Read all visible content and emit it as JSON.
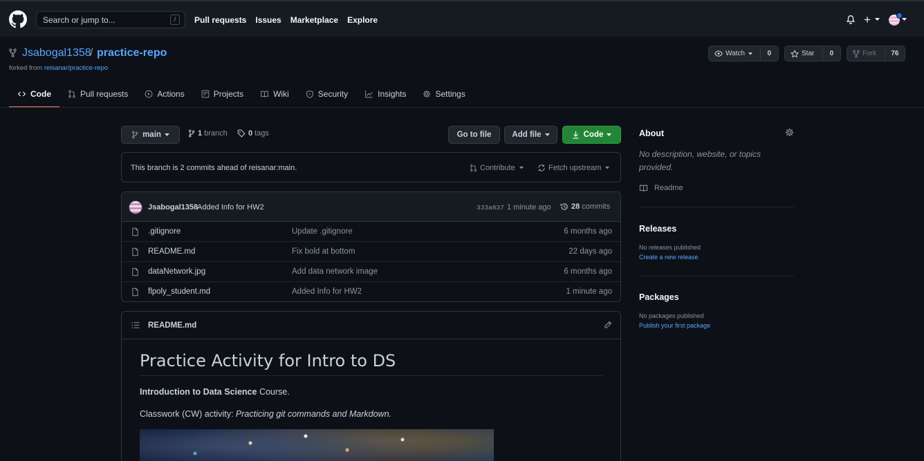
{
  "header": {
    "search_placeholder": "Search or jump to...",
    "search_shortcut": "/",
    "nav": [
      "Pull requests",
      "Issues",
      "Marketplace",
      "Explore"
    ],
    "plus": "+"
  },
  "repo": {
    "owner": "Jsabogal1358",
    "separator": "/",
    "name": "practice-repo",
    "forked_prefix": "forked from",
    "forked_source": "reisanar/practice-repo",
    "watch_label": "Watch",
    "watch_count": "0",
    "star_label": "Star",
    "star_count": "0",
    "fork_label": "Fork",
    "fork_count": "76"
  },
  "tabs": [
    {
      "label": "Code",
      "icon": "code-icon",
      "active": true
    },
    {
      "label": "Pull requests",
      "icon": "pull-request-icon"
    },
    {
      "label": "Actions",
      "icon": "play-icon"
    },
    {
      "label": "Projects",
      "icon": "project-icon"
    },
    {
      "label": "Wiki",
      "icon": "book-icon"
    },
    {
      "label": "Security",
      "icon": "shield-icon"
    },
    {
      "label": "Insights",
      "icon": "graph-icon"
    },
    {
      "label": "Settings",
      "icon": "gear-icon"
    }
  ],
  "branch_bar": {
    "branch": "main",
    "branch_count": "1",
    "branch_word": "branch",
    "tag_count": "0",
    "tag_word": "tags",
    "go_to_file": "Go to file",
    "add_file": "Add file",
    "code": "Code"
  },
  "ahead": {
    "text": "This branch is 2 commits ahead of reisanar:main.",
    "contribute": "Contribute",
    "fetch_upstream": "Fetch upstream"
  },
  "latest_commit": {
    "author": "Jsabogal1358",
    "message": "Added Info for HW2",
    "sha": "333a837",
    "time": "1 minute ago",
    "count": "28",
    "count_word": "commits"
  },
  "files": [
    {
      "name": ".gitignore",
      "message": "Update .gitignore",
      "time": "6 months ago"
    },
    {
      "name": "README.md",
      "message": "Fix bold at bottom",
      "time": "22 days ago"
    },
    {
      "name": "dataNetwork.jpg",
      "message": "Add data network image",
      "time": "6 months ago"
    },
    {
      "name": "flpoly_student.md",
      "message": "Added Info for HW2",
      "time": "1 minute ago"
    }
  ],
  "readme": {
    "filename": "README.md",
    "title": "Practice Activity for Intro to DS",
    "p1_bold": "Introduction to Data Science",
    "p1_rest": " Course.",
    "p2_start": "Classwork (CW) activity: ",
    "p2_italic": "Practicing git commands and Markdown."
  },
  "sidebar": {
    "about_title": "About",
    "about_desc": "No description, website, or topics provided.",
    "readme_link": "Readme",
    "releases_title": "Releases",
    "releases_none": "No releases published",
    "releases_create": "Create a new release",
    "packages_title": "Packages",
    "packages_none": "No packages published",
    "packages_publish": "Publish your first package"
  },
  "colors": {
    "background": "#0d1117",
    "header": "#161b22",
    "link": "#58a6ff",
    "primary_button": "#238636",
    "active_tab_underline": "#f78166"
  }
}
